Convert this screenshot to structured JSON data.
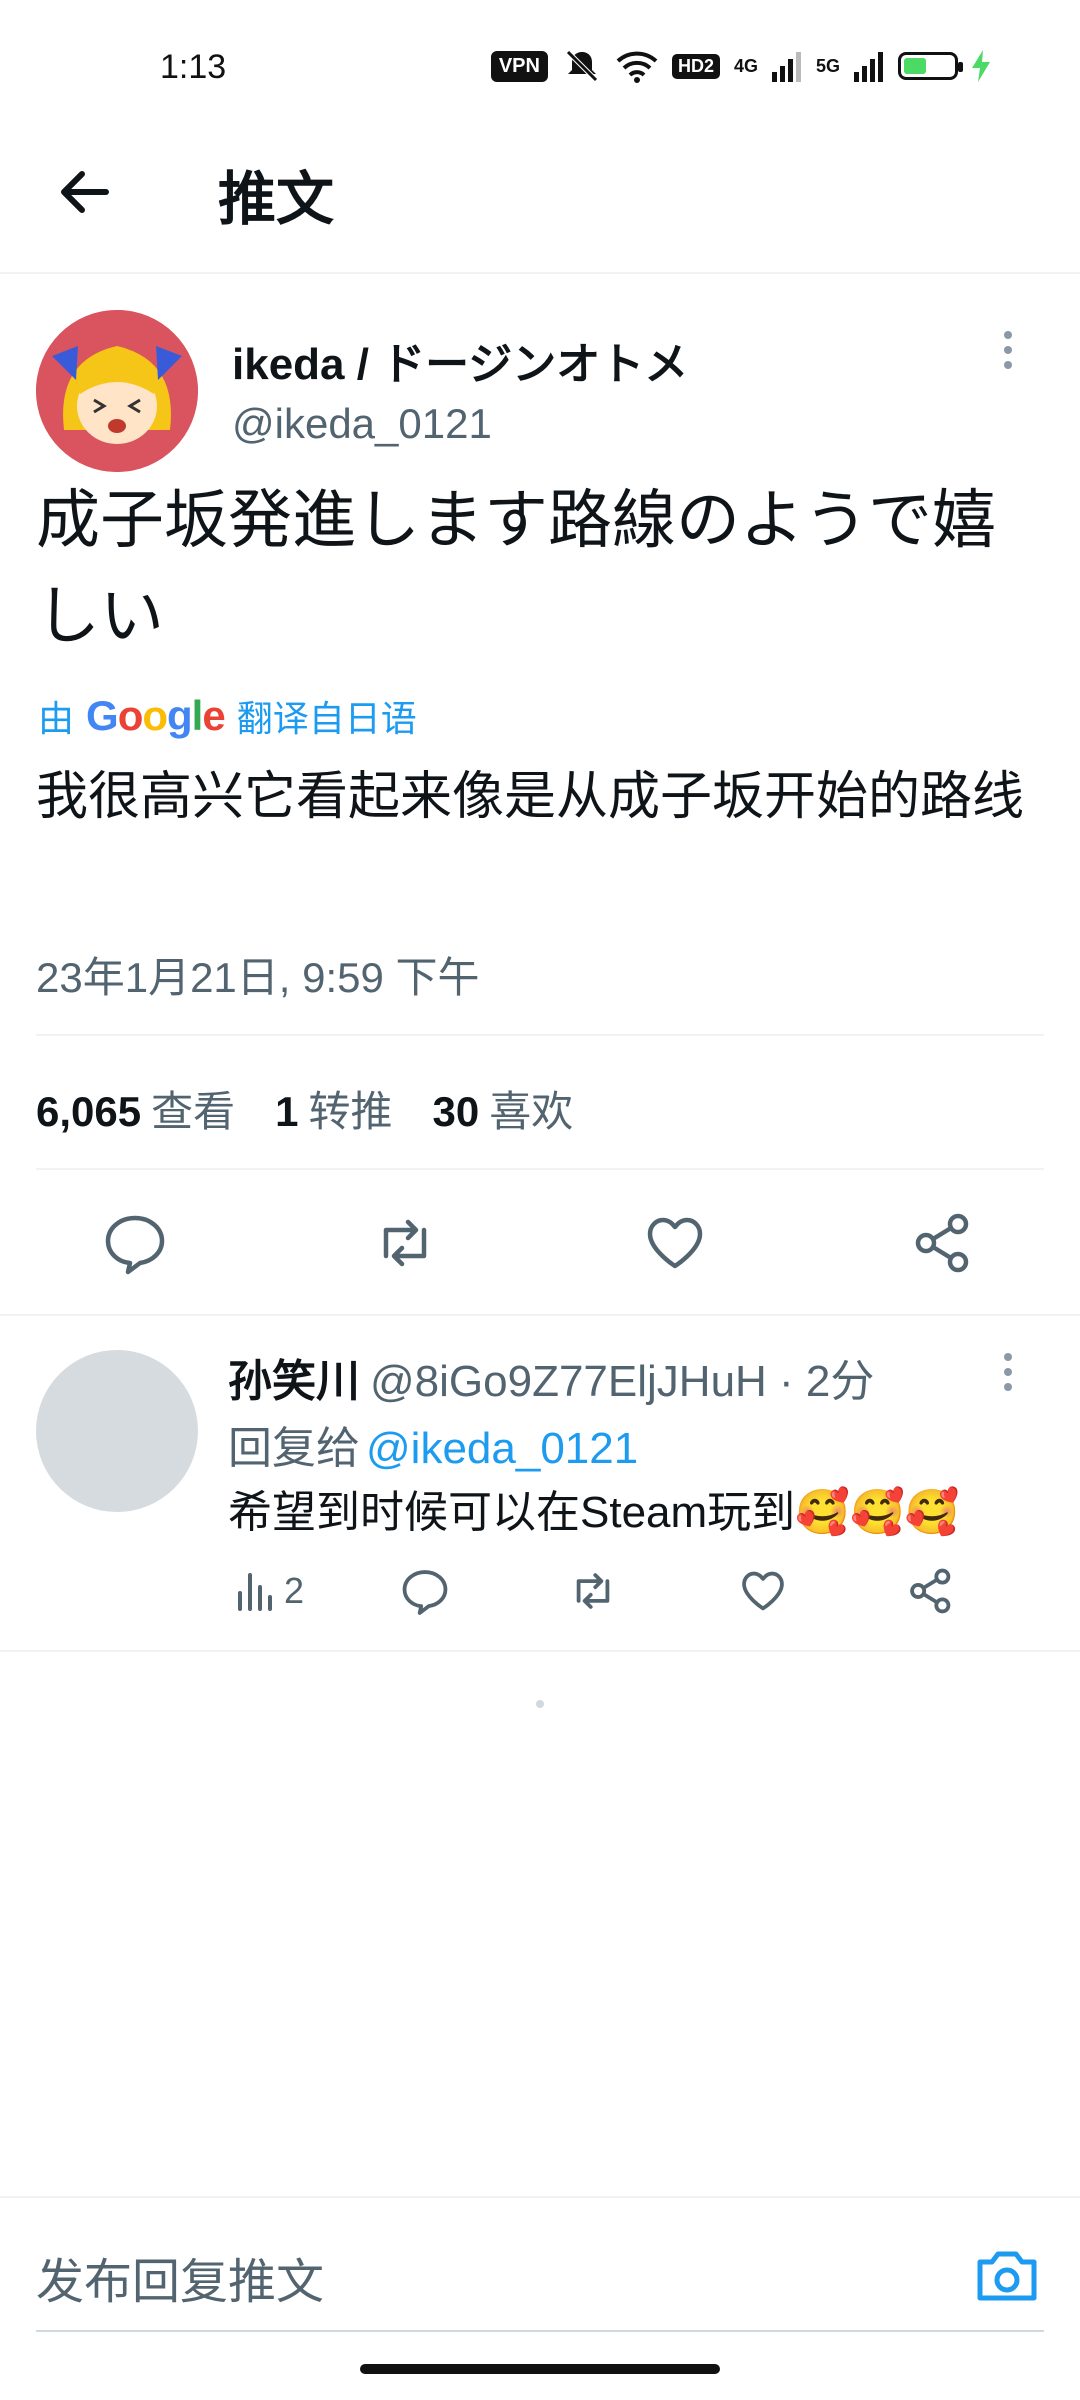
{
  "status_bar": {
    "time": "1:13",
    "vpn": "VPN",
    "hd": "HD2",
    "net1": "4G",
    "net2": "5G",
    "battery_level": 0.45,
    "battery_color": "#4cd964"
  },
  "header": {
    "title": "推文",
    "back_icon": "arrow-left-icon"
  },
  "tweet": {
    "author_name": "ikeda / ドージンオトメ",
    "author_handle": "@ikeda_0121",
    "text": "成子坂発進します路線のようで嬉しい",
    "translate_prefix": "由",
    "translate_brand": [
      "G",
      "o",
      "o",
      "g",
      "l",
      "e"
    ],
    "translate_brand_colors": [
      "#4285f4",
      "#ea4335",
      "#fbbc05",
      "#4285f4",
      "#34a853",
      "#ea4335"
    ],
    "translate_suffix": "翻译自日语",
    "translated_text": "我很高兴它看起来像是从成子坂开始的路线",
    "timestamp": "23年1月21日, 9:59 下午",
    "stats": {
      "views": "6,065",
      "views_label": "查看",
      "retweets": "1",
      "retweets_label": "转推",
      "likes": "30",
      "likes_label": "喜欢"
    },
    "avatar_color": "#d9545e"
  },
  "reply": {
    "name": "孙笑川",
    "meta": "@8iGo9Z77EljJHuH · 2分",
    "reply_to_label": "回复给",
    "reply_to_handle": "@ikeda_0121",
    "text": "希望到时候可以在Steam玩到🥰🥰🥰",
    "views": "2"
  },
  "compose": {
    "placeholder": "发布回复推文"
  },
  "colors": {
    "accent": "#1d9bf0",
    "muted": "#536471",
    "text": "#0f1419"
  }
}
